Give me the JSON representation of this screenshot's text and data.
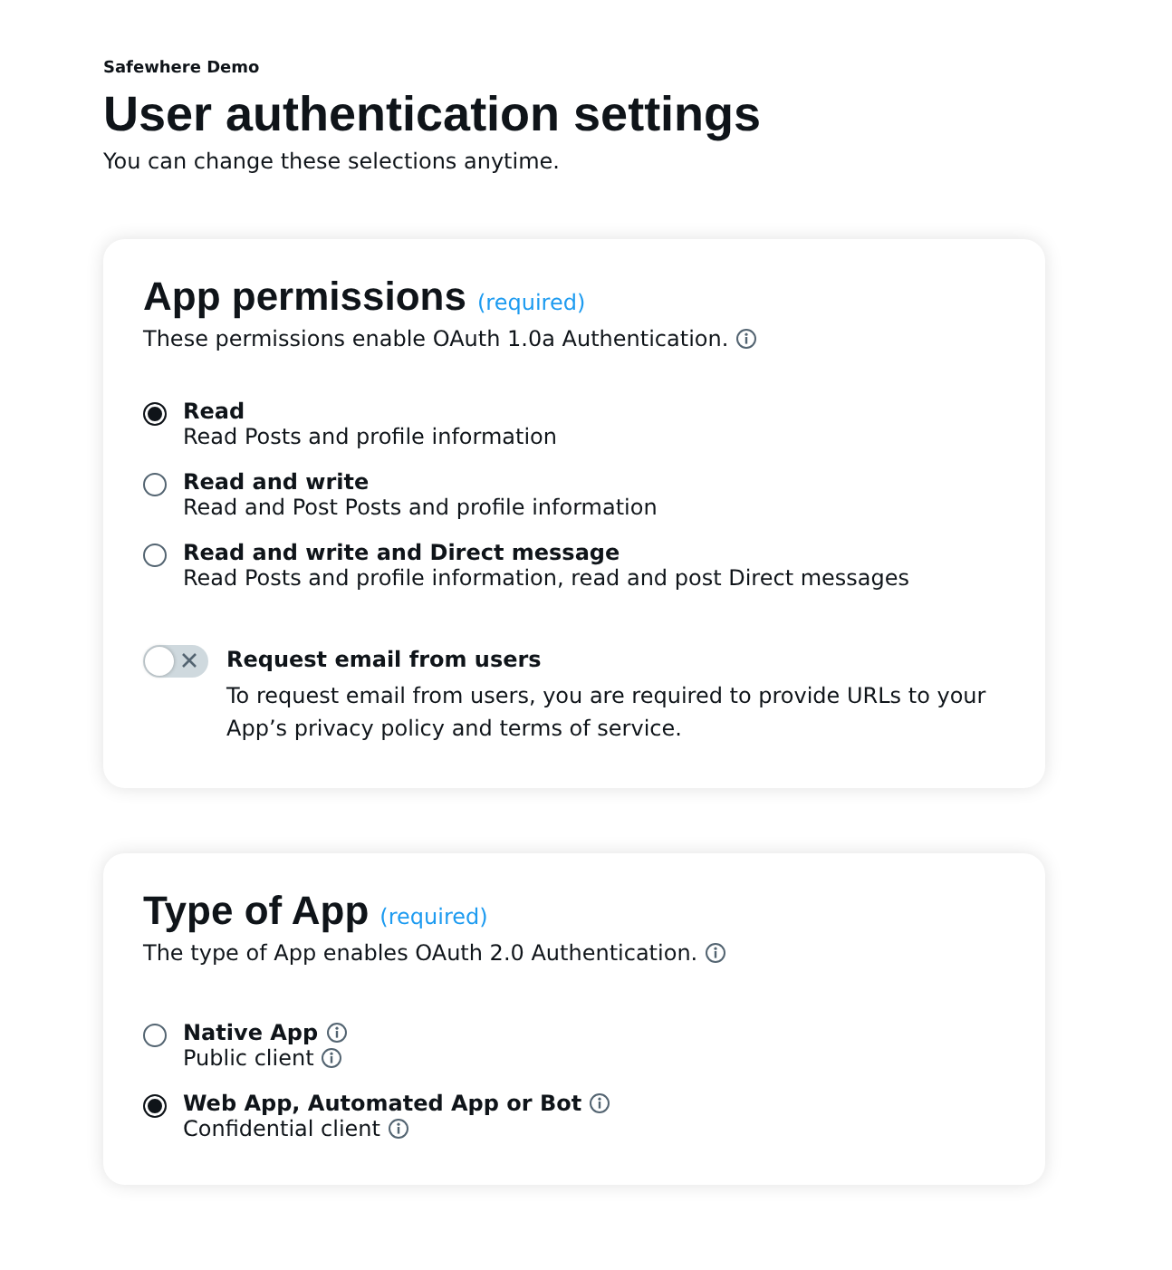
{
  "app_name": "Safewhere Demo",
  "title": "User authentication settings",
  "subtitle": "You can change these selections anytime.",
  "sections": [
    {
      "title": "App permissions",
      "required": "(required)",
      "description": "These permissions enable OAuth 1.0a Authentication.",
      "options": [
        {
          "label": "Read",
          "sublabel": "Read Posts and profile information",
          "selected": true,
          "has_info": false
        },
        {
          "label": "Read and write",
          "sublabel": "Read and Post Posts and profile information",
          "selected": false,
          "has_info": false
        },
        {
          "label": "Read and write and Direct message",
          "sublabel": "Read Posts and profile information, read and post Direct messages",
          "selected": false,
          "has_info": false
        }
      ],
      "toggle": {
        "label": "Request email from users",
        "description": "To request email from users, you are required to provide URLs to your App’s privacy policy and terms of service.",
        "on": false
      }
    },
    {
      "title": "Type of App",
      "required": "(required)",
      "description": "The type of App enables OAuth 2.0 Authentication.",
      "options": [
        {
          "label": "Native App",
          "sublabel": "Public client",
          "selected": false,
          "has_info": true
        },
        {
          "label": "Web App, Automated App or Bot",
          "sublabel": "Confidential client",
          "selected": true,
          "has_info": true
        }
      ]
    }
  ]
}
